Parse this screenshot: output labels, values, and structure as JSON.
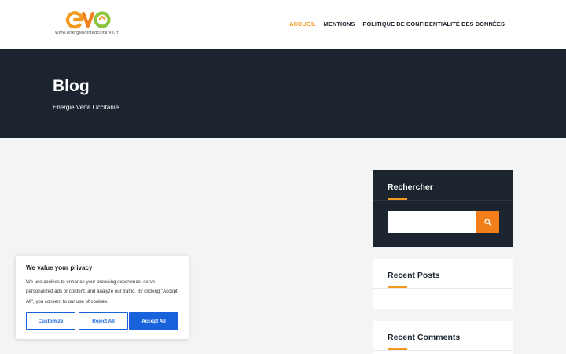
{
  "header": {
    "logo_url_text": "www.energieverteoccitanie.fr",
    "nav": [
      {
        "label": "ACCUEIL",
        "active": true
      },
      {
        "label": "MENTIONS",
        "active": false
      },
      {
        "label": "POLITIQUE DE CONFIDENTIALITÉ DES DONNÉES",
        "active": false
      }
    ]
  },
  "hero": {
    "title": "Blog",
    "subtitle": "Energie Verte Occitanie"
  },
  "sidebar": {
    "search": {
      "title": "Rechercher",
      "placeholder": "",
      "button_icon": "search-icon"
    },
    "recent_posts": {
      "title": "Recent Posts"
    },
    "recent_comments": {
      "title": "Recent Comments"
    }
  },
  "cookie_banner": {
    "title": "We value your privacy",
    "text": "We use cookies to enhance your browsing experience, serve personalized ads or content, and analyze our traffic. By clicking \"Accept All\", you consent to our use of cookies.",
    "customize_label": "Customize",
    "reject_label": "Reject All",
    "accept_label": "Accept All"
  },
  "colors": {
    "accent": "#f39a1e",
    "dark": "#1b242f",
    "cookie_blue": "#1863dc"
  }
}
